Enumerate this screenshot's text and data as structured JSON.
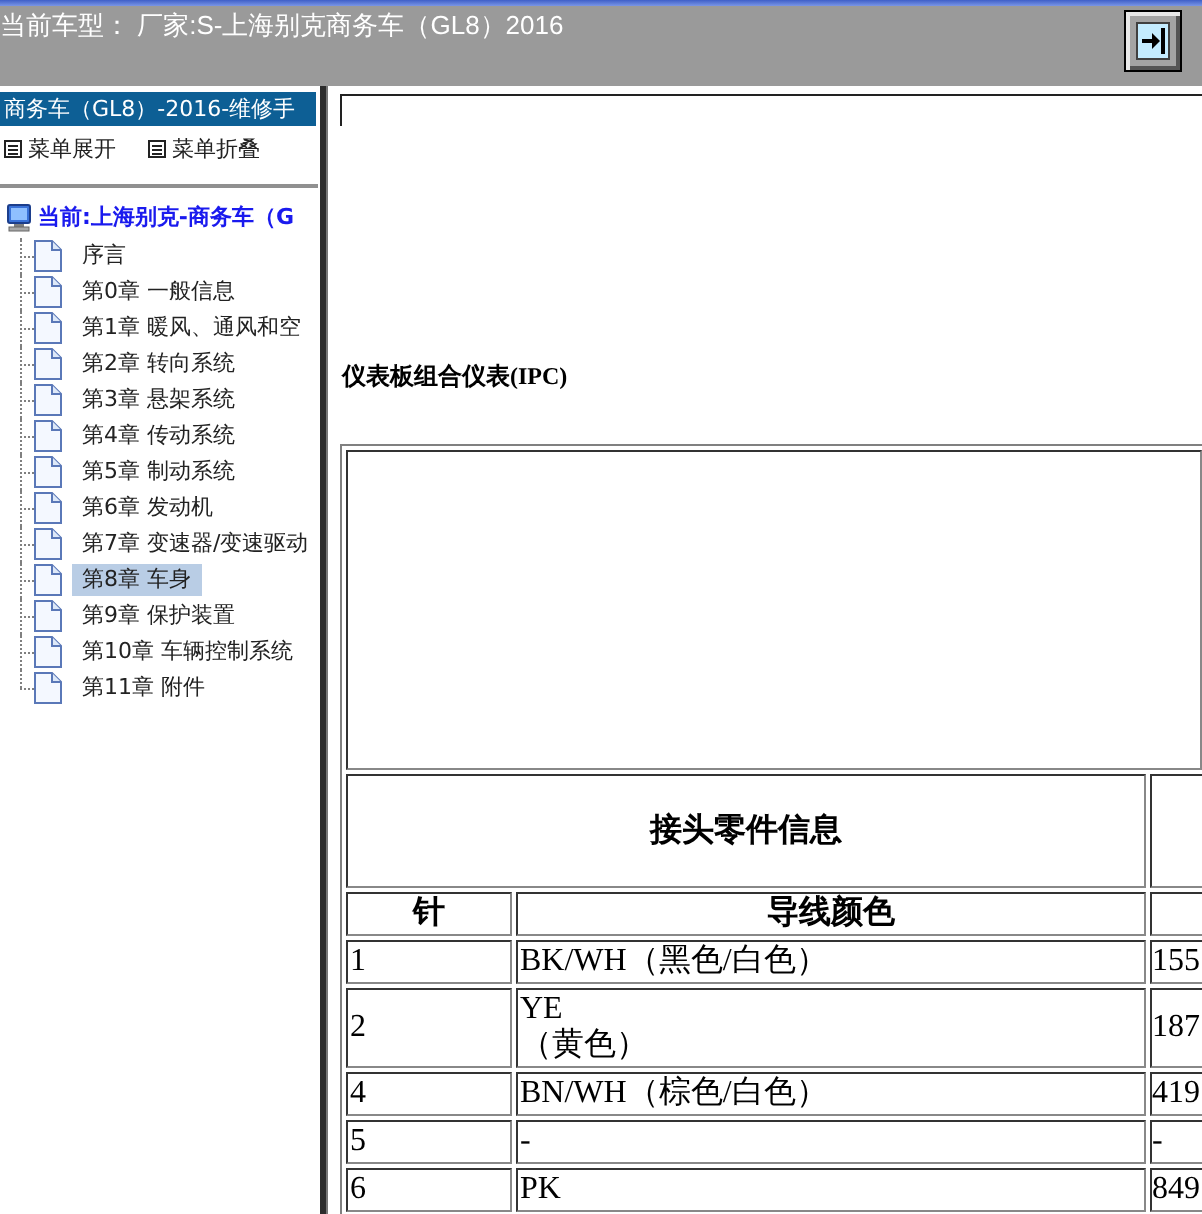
{
  "title_bar": {
    "title": "当前车型： 厂家:S-上海别克商务车（GL8）2016"
  },
  "sidebar": {
    "header": "商务车（GL8）-2016-维修手",
    "menu_actions": [
      "菜单展开",
      "菜单折叠"
    ],
    "tree": {
      "label": "当前:上海别克-商务车（G",
      "children": [
        {
          "label": "序言",
          "selected": false
        },
        {
          "label": "第0章 一般信息",
          "selected": false
        },
        {
          "label": "第1章 暖风、通风和空",
          "selected": false
        },
        {
          "label": "第2章 转向系统",
          "selected": false
        },
        {
          "label": "第3章 悬架系统",
          "selected": false
        },
        {
          "label": "第4章 传动系统",
          "selected": false
        },
        {
          "label": "第5章 制动系统",
          "selected": false
        },
        {
          "label": "第6章 发动机",
          "selected": false
        },
        {
          "label": "第7章 变速器/变速驱动",
          "selected": false
        },
        {
          "label": "第8章 车身",
          "selected": true
        },
        {
          "label": "第9章 保护装置",
          "selected": false
        },
        {
          "label": "第10章 车辆控制系统",
          "selected": false
        },
        {
          "label": "第11章 附件",
          "selected": false
        }
      ]
    }
  },
  "document": {
    "heading": "仪表板组合仪表(IPC)",
    "table": {
      "title": "接头零件信息",
      "columns": [
        "针",
        "导线颜色"
      ],
      "rows": [
        {
          "pin": "1",
          "wire_color": "BK/WH（黑色/白色）",
          "column_3": "155"
        },
        {
          "pin": "2",
          "wire_color": "YE\n（黄色）",
          "column_3": "187"
        },
        {
          "pin": "4",
          "wire_color": "BN/WH（棕色/白色）",
          "column_3": "419"
        },
        {
          "pin": "5",
          "wire_color": "-",
          "column_3": "-"
        },
        {
          "pin": "6",
          "wire_color": "PK",
          "column_3": "849"
        }
      ]
    }
  }
}
